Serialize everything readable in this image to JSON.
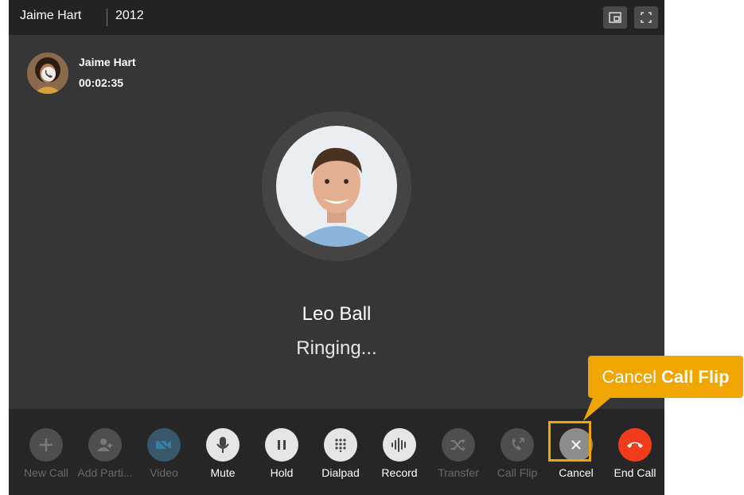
{
  "window": {
    "title_name": "Jaime Hart",
    "title_extension": "2012",
    "buttons": [
      {
        "icon": "picture-in-picture-icon"
      },
      {
        "icon": "fullscreen-icon"
      }
    ]
  },
  "current_call": {
    "name": "Jaime Hart",
    "duration": "00:02:35"
  },
  "flip_target": {
    "name": "Leo Ball",
    "status": "Ringing..."
  },
  "toolbar": {
    "new_call": "New Call",
    "add_participant": "Add Parti...",
    "video": "Video",
    "mute": "Mute",
    "hold": "Hold",
    "dialpad": "Dialpad",
    "record": "Record",
    "transfer": "Transfer",
    "call_flip": "Call Flip",
    "cancel": "Cancel",
    "end_call": "End Call"
  },
  "callout": {
    "prefix": "Cancel",
    "bold": "Call Flip",
    "color": "#f0a500"
  },
  "colors": {
    "window_bg": "#363636",
    "toolbar_bg": "#262626",
    "end_call": "#f23b1c"
  }
}
